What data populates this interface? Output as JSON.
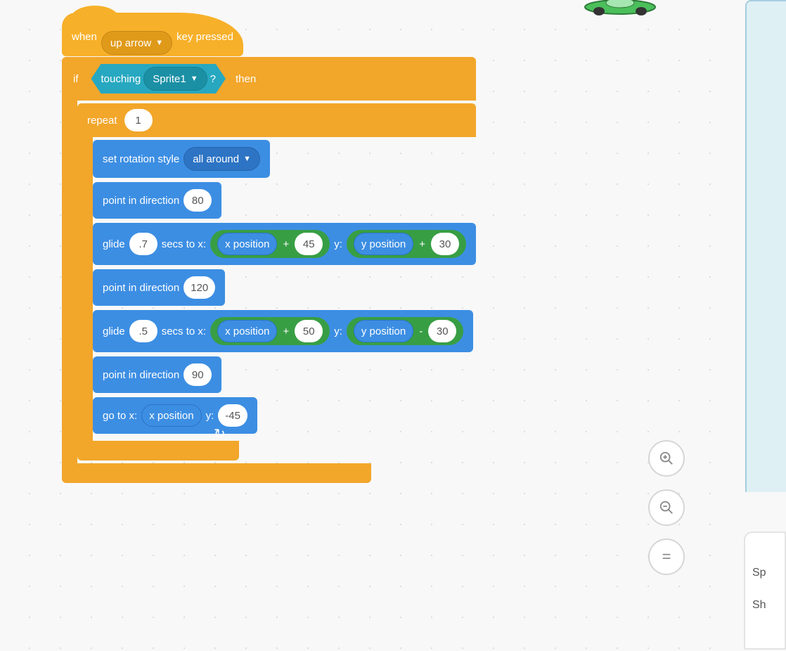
{
  "hat": {
    "prefix": "when",
    "key": "up arrow",
    "suffix": "key pressed"
  },
  "if_block": {
    "if_label": "if",
    "touching_label": "touching",
    "touching_target": "Sprite1",
    "question_mark": "?",
    "then_label": "then"
  },
  "repeat": {
    "label": "repeat",
    "count": "1"
  },
  "blocks": {
    "set_rotation": {
      "label": "set rotation style",
      "option": "all around"
    },
    "point1": {
      "label": "point in direction",
      "value": "80"
    },
    "glide1": {
      "glide": "glide",
      "secs": ".7",
      "secs_to_x": "secs to x:",
      "x_reporter": "x position",
      "x_plus": "+",
      "x_val": "45",
      "y_label": "y:",
      "y_reporter": "y position",
      "y_op": "+",
      "y_val": "30"
    },
    "point2": {
      "label": "point in direction",
      "value": "120"
    },
    "glide2": {
      "glide": "glide",
      "secs": ".5",
      "secs_to_x": "secs to x:",
      "x_reporter": "x position",
      "x_plus": "+",
      "x_val": "50",
      "y_label": "y:",
      "y_reporter": "y position",
      "y_op": "-",
      "y_val": "30"
    },
    "point3": {
      "label": "point in direction",
      "value": "90"
    },
    "goto": {
      "label": "go to x:",
      "x_reporter": "x position",
      "y_label": "y:",
      "y_val": "-45"
    }
  },
  "right_card": {
    "line1": "Sp",
    "line2": "Sh"
  },
  "zoom": {
    "in": "⊕",
    "out": "⊖",
    "eq": "="
  },
  "repeat_arrow": "↻"
}
